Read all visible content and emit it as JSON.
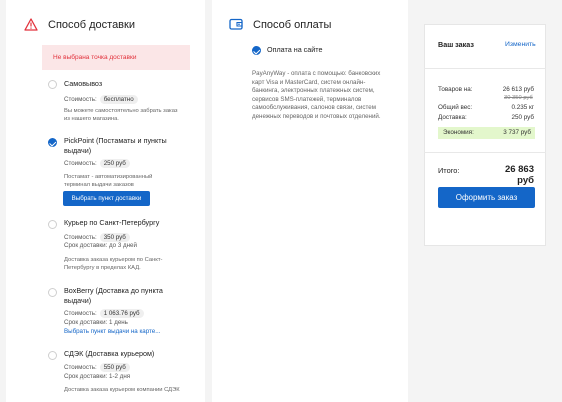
{
  "delivery": {
    "title": "Способ доставки",
    "warning": "Не выбрана точка доставки",
    "options": [
      {
        "title": "Самовывоз",
        "cost_label": "Стоимость:",
        "cost_value": "бесплатно",
        "note": [
          "Вы можете самостоятельно забрать заказ",
          "из нашего магазина."
        ],
        "selected": false
      },
      {
        "title": [
          "PickPoint (Постаматы и пункты",
          "выдачи)"
        ],
        "cost_label": "Стоимость:",
        "cost_value": "250 руб",
        "note": [
          "Постамат - автоматизированный",
          "терминал выдачи заказов"
        ],
        "button": "Выбрать пункт доставки",
        "selected": true
      },
      {
        "title": "Курьер по Санкт-Петербургу",
        "cost_label": "Стоимость:",
        "cost_value": "350 руб",
        "term_label": "Срок доставки:",
        "term_value": "до 3 дней",
        "note": [
          "Доставка заказа курьером по Санкт-",
          "Петербургу в пределах КАД."
        ],
        "selected": false
      },
      {
        "title": [
          "BoxBerry (Доставка до пункта",
          "выдачи)"
        ],
        "cost_label": "Стоимость:",
        "cost_value": "1 063.76 руб",
        "term_label": "Срок доставки:",
        "term_value": "1 день",
        "link": "Выбрать пункт выдачи на карте...",
        "selected": false
      },
      {
        "title": "СДЭК (Доставка курьером)",
        "cost_label": "Стоимость:",
        "cost_value": "550 руб",
        "term_label": "Срок доставки:",
        "term_value": "1-2 дня",
        "note": [
          "Доставка заказа курьером компании СДЭК"
        ],
        "selected": false
      }
    ]
  },
  "payment": {
    "title": "Способ оплаты",
    "option": "Оплата на сайте",
    "description": [
      "PayAnyWay - оплата с помощью: банковских",
      "карт Visa и MasterCard, систем онлайн-",
      "банкинга, электронных платежных систем,",
      "сервисов SMS-платежей, терминалов",
      "самообслуживания, салонов связи, систем",
      "денежных переводов и почтовых отделений."
    ]
  },
  "order": {
    "title": "Ваш заказ",
    "change_link": "Изменить",
    "goods_label": "Товаров на:",
    "goods_value": "26 613 руб",
    "goods_old": "30 350 руб",
    "weight_label": "Общий вес:",
    "weight_value": "0.235 кг",
    "delivery_label": "Доставка:",
    "delivery_value": "250 руб",
    "economy_label": "Экономия:",
    "economy_value": "3 737 руб",
    "total_label": "Итого:",
    "total_value": "26 863 руб",
    "submit": "Оформить заказ"
  },
  "colors": {
    "accent": "#1466c8",
    "warning": "#e2323c",
    "economy_bg": "#e3f7cc"
  }
}
